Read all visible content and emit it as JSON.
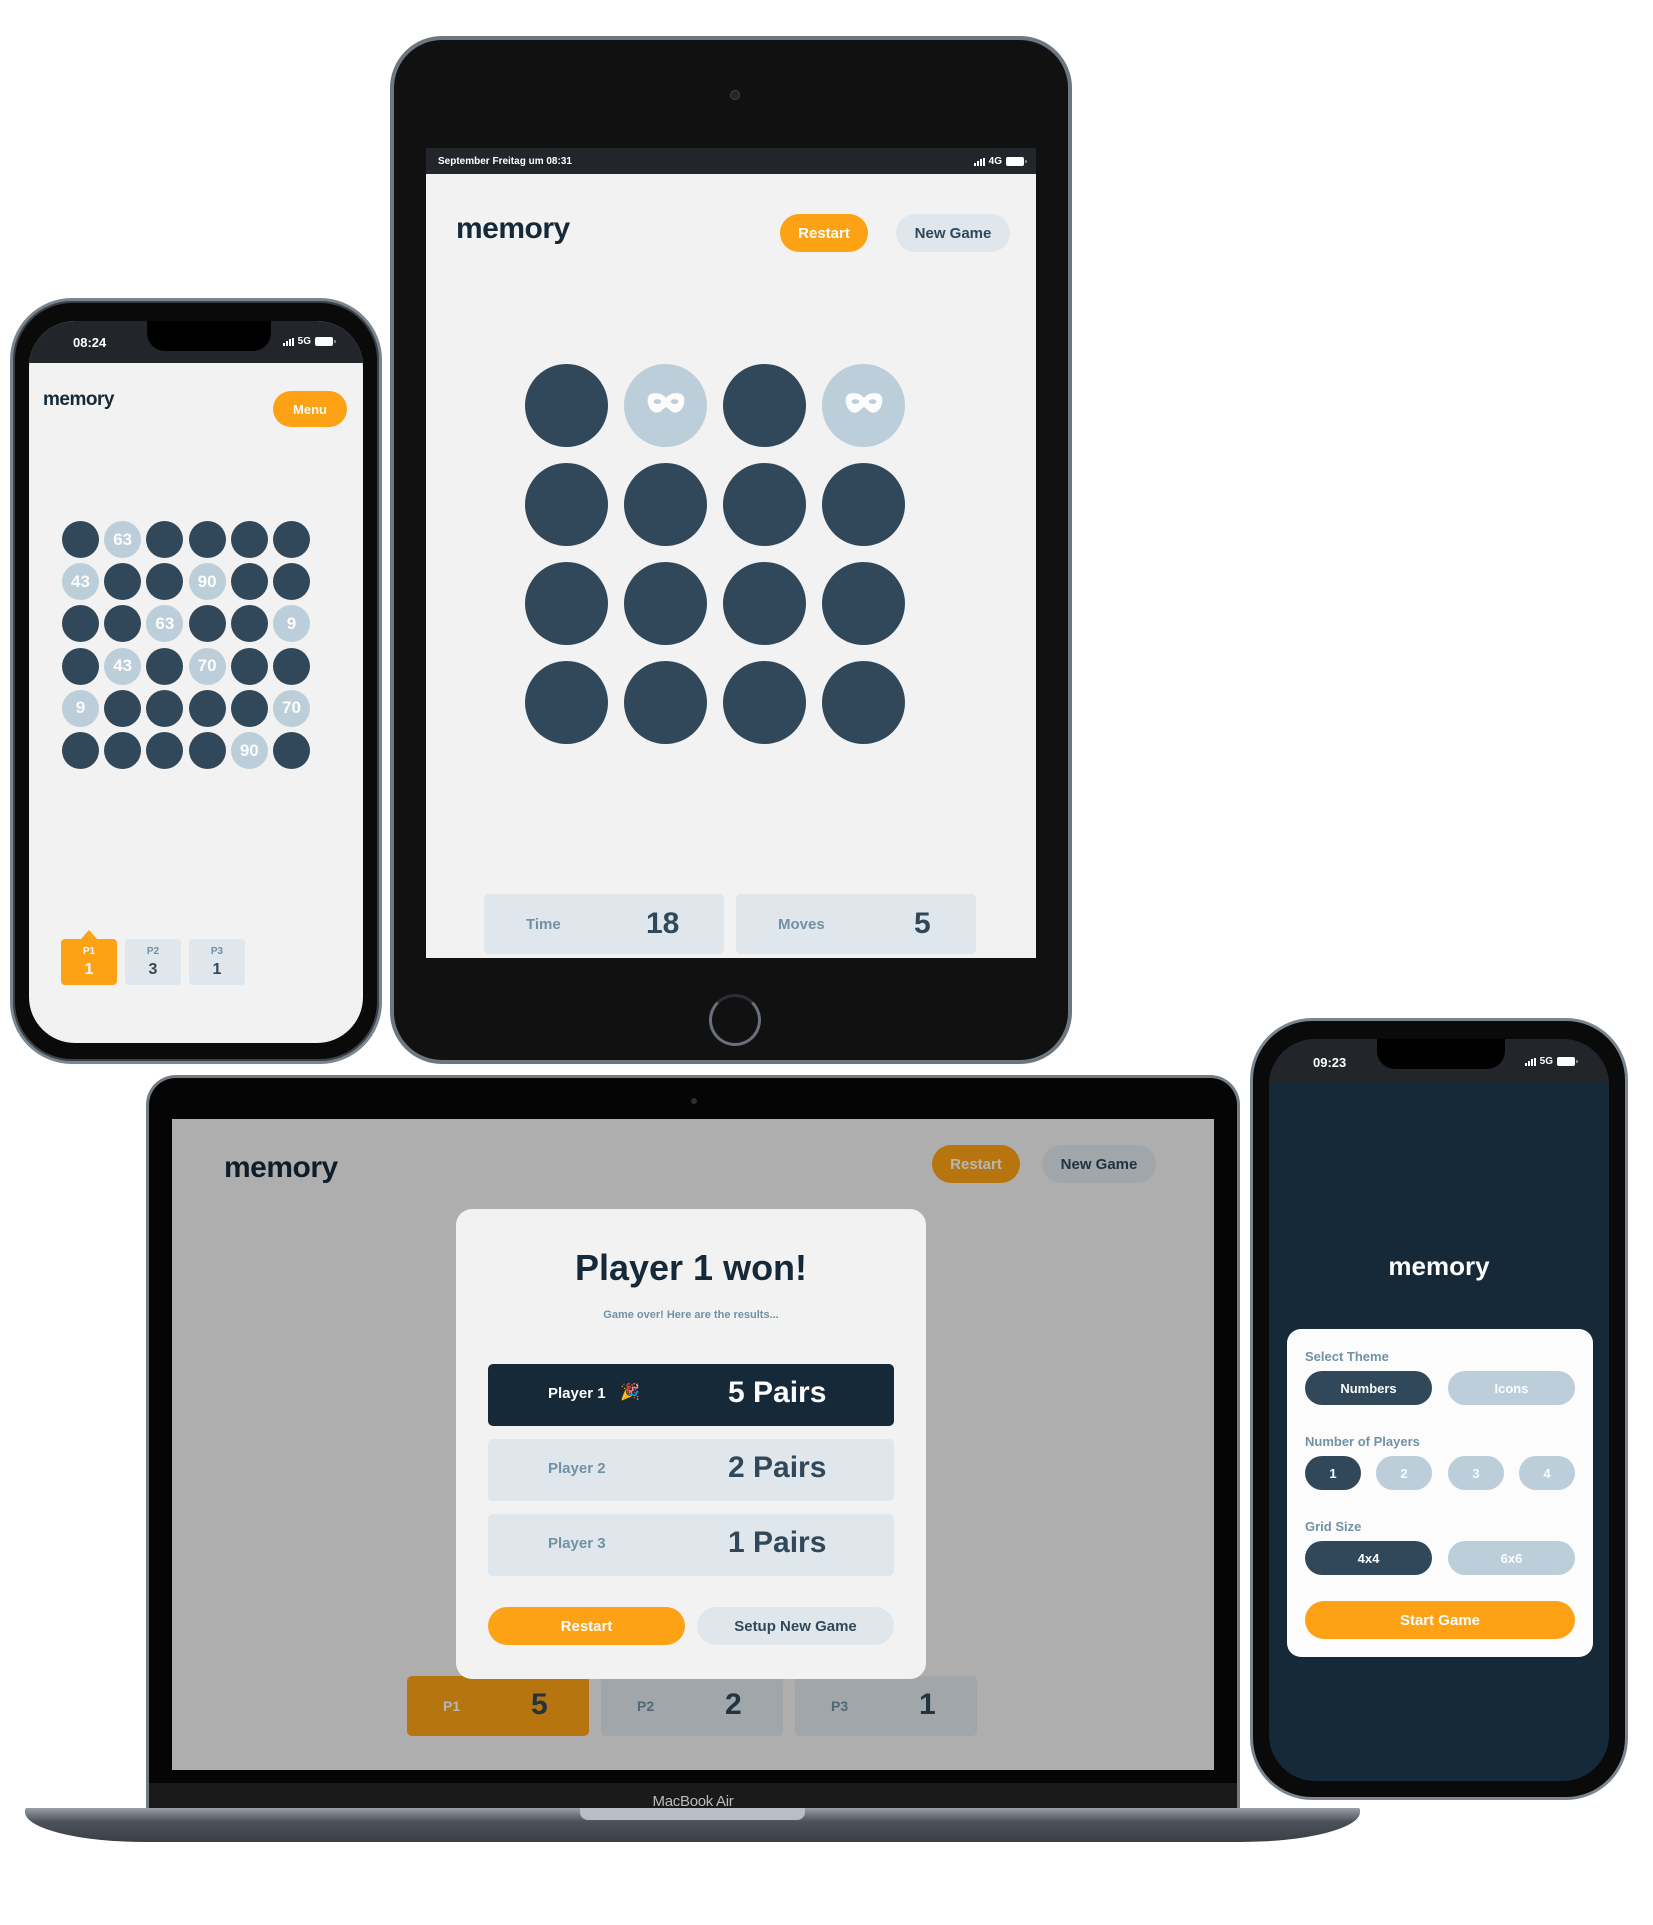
{
  "colors": {
    "orange": "#fda214",
    "navy": "#152938",
    "tile_hidden": "#304859",
    "tile_shown": "#bcced9",
    "light": "#dfe7ec",
    "background": "#f2f2f2"
  },
  "phone_left": {
    "status": {
      "time": "08:24",
      "network": "5G"
    },
    "header": {
      "logo": "memory",
      "menu_label": "Menu"
    },
    "board": {
      "theme": "numbers",
      "size": "6x6",
      "tiles": [
        [
          null,
          "63",
          null,
          null,
          null,
          null
        ],
        [
          "43",
          null,
          null,
          "90",
          null,
          null
        ],
        [
          null,
          null,
          "63",
          null,
          null,
          "9"
        ],
        [
          null,
          "43",
          null,
          "70",
          null,
          null
        ],
        [
          "9",
          null,
          null,
          null,
          null,
          "70"
        ],
        [
          null,
          null,
          null,
          null,
          "90",
          null
        ]
      ]
    },
    "players": [
      {
        "label": "P1",
        "score": "1",
        "active": true
      },
      {
        "label": "P2",
        "score": "3",
        "active": false
      },
      {
        "label": "P3",
        "score": "1",
        "active": false
      }
    ]
  },
  "ipad": {
    "status": {
      "time": "September Freitag um 08:31",
      "network": "4G"
    },
    "header": {
      "logo": "memory",
      "restart_label": "Restart",
      "new_game_label": "New Game"
    },
    "board": {
      "theme": "icons",
      "size": "4x4",
      "tiles": [
        [
          null,
          "mask-icon",
          null,
          "mask-icon"
        ],
        [
          null,
          null,
          null,
          null
        ],
        [
          null,
          null,
          null,
          null
        ],
        [
          null,
          null,
          null,
          null
        ]
      ]
    },
    "stats": {
      "time_label": "Time",
      "time_value": "18",
      "moves_label": "Moves",
      "moves_value": "5"
    }
  },
  "laptop": {
    "device_label": "MacBook Air",
    "header": {
      "logo": "memory",
      "restart_label": "Restart",
      "new_game_label": "New Game"
    },
    "modal": {
      "title": "Player 1 won!",
      "subtitle": "Game over! Here are the results...",
      "winner_icon": "party-popper-icon",
      "results": [
        {
          "name": "Player 1",
          "value": "5 Pairs",
          "winner": true
        },
        {
          "name": "Player 2",
          "value": "2 Pairs",
          "winner": false
        },
        {
          "name": "Player 3",
          "value": "1 Pairs",
          "winner": false
        }
      ],
      "restart_label": "Restart",
      "setup_label": "Setup New Game"
    },
    "players": [
      {
        "label": "P1",
        "score": "5",
        "active": true
      },
      {
        "label": "P2",
        "score": "2",
        "active": false
      },
      {
        "label": "P3",
        "score": "1",
        "active": false
      }
    ]
  },
  "phone_right": {
    "status": {
      "time": "09:23",
      "network": "5G"
    },
    "logo": "memory",
    "setup": {
      "theme_label": "Select Theme",
      "theme_options": [
        {
          "label": "Numbers",
          "active": true
        },
        {
          "label": "Icons",
          "active": false
        }
      ],
      "players_label": "Number of Players",
      "players_options": [
        {
          "label": "1",
          "active": true
        },
        {
          "label": "2",
          "active": false
        },
        {
          "label": "3",
          "active": false
        },
        {
          "label": "4",
          "active": false
        }
      ],
      "grid_label": "Grid Size",
      "grid_options": [
        {
          "label": "4x4",
          "active": true
        },
        {
          "label": "6x6",
          "active": false
        }
      ],
      "start_label": "Start Game"
    }
  }
}
